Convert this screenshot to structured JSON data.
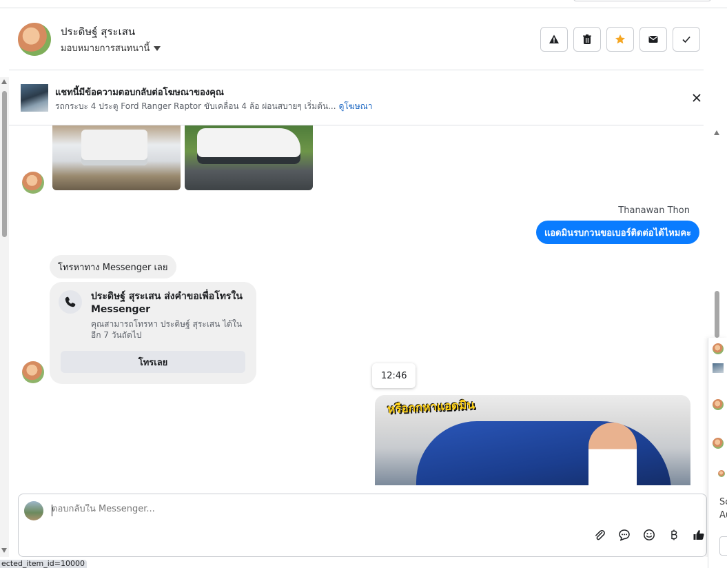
{
  "header": {
    "contact_name": "ประดิษฐ์ สุระเสน",
    "assign_label": "มอบหมายการสนทนานี้",
    "actions": [
      "report",
      "delete",
      "star",
      "mark-unread",
      "done"
    ]
  },
  "ad_bar": {
    "title": "แชทนี้มีข้อความตอบกลับต่อโฆษณาของคุณ",
    "subtitle": "รถกระบะ 4 ประตู Ford Ranger Raptor ขับเคลื่อน 4 ล้อ ผ่อนสบายๆ เริ่มต้น...",
    "link": "ดูโฆษณา"
  },
  "thread": {
    "outgoing_sender": "Thanawan Thon",
    "outgoing_message": "แอดมินรบกวนขอเบอร์ติดต่อได้ไหมคะ",
    "incoming_message": "โทรหาทาง Messenger เลย",
    "call_card": {
      "title": "ประดิษฐ์ สุระเสน ส่งคำขอเพื่อโทรใน Messenger",
      "description": "คุณสามารถโทรหา ประดิษฐ์ สุระเสน ได้ในอีก 7 วันถัดไป",
      "button": "โทรเลย"
    },
    "timestamp": "12:46",
    "video_caption": "หรือกกหาแอดมิน"
  },
  "composer": {
    "placeholder": "ตอบกลับใน Messenger..."
  },
  "side_panel": {
    "text_1": "So",
    "text_2": "Au"
  },
  "status_bar": "ected_item_id=10000",
  "colors": {
    "accent": "#0a7cff",
    "star": "#f5a623",
    "link": "#1a66c2"
  }
}
